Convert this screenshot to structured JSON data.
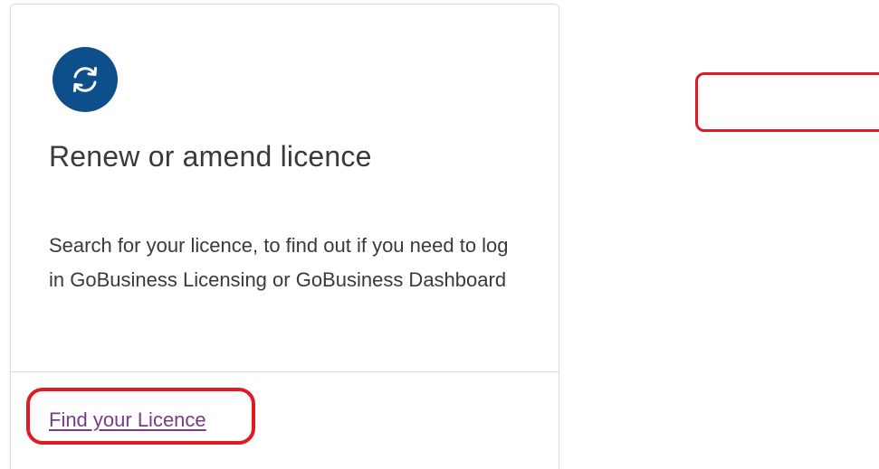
{
  "card": {
    "icon": "renew-arrows-icon",
    "title": "Renew or amend licence",
    "description": "Search for your licence, to find out if you need to log in GoBusiness Licensing or GoBusiness Dashboard",
    "link_label": "Find your Licence"
  },
  "colors": {
    "icon_background": "#0c4f8a",
    "link": "#7a3a8c",
    "highlight": "#e01b24",
    "text": "#3a3a3a"
  }
}
